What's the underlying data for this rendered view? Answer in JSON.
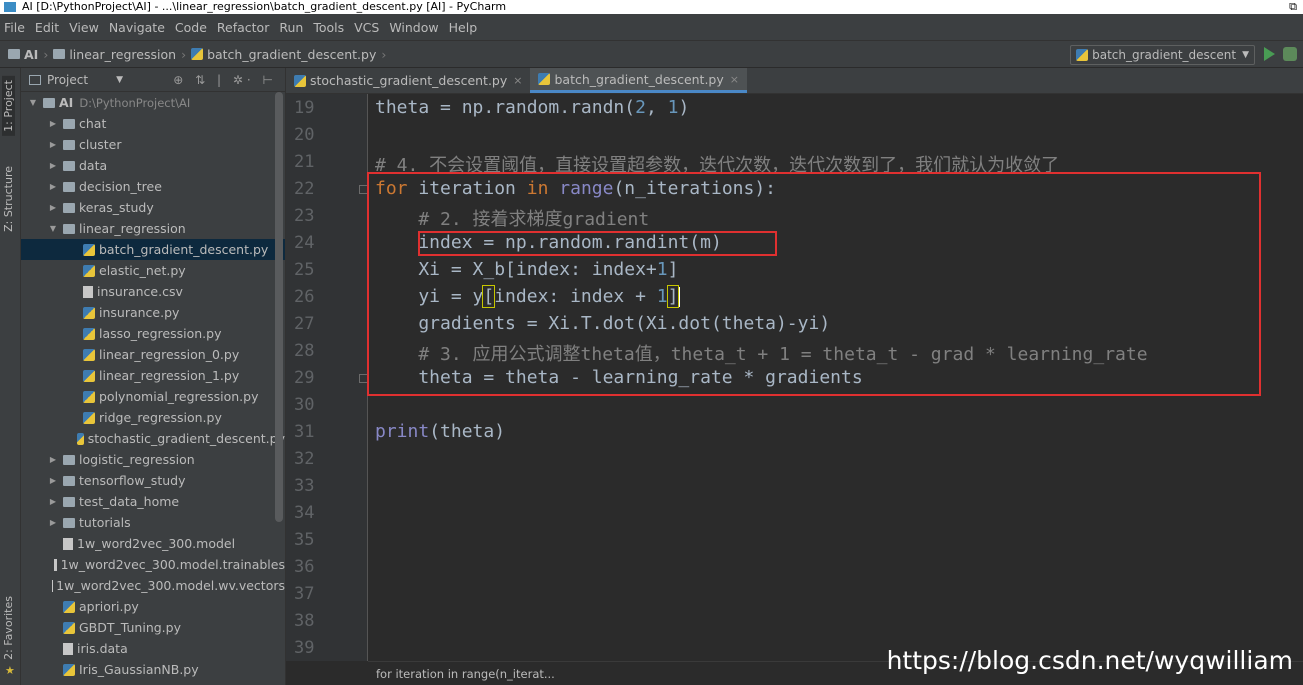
{
  "window": {
    "title": "AI [D:\\PythonProject\\AI] - ...\\linear_regression\\batch_gradient_descent.py [AI] - PyCharm",
    "restore_glyph": "⧉"
  },
  "menu": [
    "File",
    "Edit",
    "View",
    "Navigate",
    "Code",
    "Refactor",
    "Run",
    "Tools",
    "VCS",
    "Window",
    "Help"
  ],
  "nav": {
    "crumbs": [
      "AI",
      "linear_regression",
      "batch_gradient_descent.py"
    ],
    "separator": "›",
    "run_config": "batch_gradient_descent"
  },
  "toolstrip": {
    "project_tab": "1: Project",
    "structure_tab": "Z: Structure",
    "favorites_tab": "2: Favorites"
  },
  "project_panel": {
    "header": "Project",
    "tools": "⊕ ⇅ | ✲· ⊢",
    "tree": [
      {
        "label": "AI",
        "path": "D:\\PythonProject\\AI",
        "type": "folder",
        "indent": 0,
        "arrow": "▼"
      },
      {
        "label": "chat",
        "type": "folder",
        "indent": 1,
        "arrow": "▶"
      },
      {
        "label": "cluster",
        "type": "folder",
        "indent": 1,
        "arrow": "▶"
      },
      {
        "label": "data",
        "type": "folder",
        "indent": 1,
        "arrow": "▶"
      },
      {
        "label": "decision_tree",
        "type": "folder",
        "indent": 1,
        "arrow": "▶"
      },
      {
        "label": "keras_study",
        "type": "folder",
        "indent": 1,
        "arrow": "▶"
      },
      {
        "label": "linear_regression",
        "type": "folder",
        "indent": 1,
        "arrow": "▼"
      },
      {
        "label": "batch_gradient_descent.py",
        "type": "py",
        "indent": 2,
        "selected": true
      },
      {
        "label": "elastic_net.py",
        "type": "py",
        "indent": 2
      },
      {
        "label": "insurance.csv",
        "type": "file",
        "indent": 2
      },
      {
        "label": "insurance.py",
        "type": "py",
        "indent": 2
      },
      {
        "label": "lasso_regression.py",
        "type": "py",
        "indent": 2
      },
      {
        "label": "linear_regression_0.py",
        "type": "py",
        "indent": 2
      },
      {
        "label": "linear_regression_1.py",
        "type": "py",
        "indent": 2
      },
      {
        "label": "polynomial_regression.py",
        "type": "py",
        "indent": 2
      },
      {
        "label": "ridge_regression.py",
        "type": "py",
        "indent": 2
      },
      {
        "label": "stochastic_gradient_descent.py",
        "type": "py",
        "indent": 2
      },
      {
        "label": "logistic_regression",
        "type": "folder",
        "indent": 1,
        "arrow": "▶"
      },
      {
        "label": "tensorflow_study",
        "type": "folder",
        "indent": 1,
        "arrow": "▶"
      },
      {
        "label": "test_data_home",
        "type": "folder",
        "indent": 1,
        "arrow": "▶"
      },
      {
        "label": "tutorials",
        "type": "folder",
        "indent": 1,
        "arrow": "▶"
      },
      {
        "label": "1w_word2vec_300.model",
        "type": "file",
        "indent": 1
      },
      {
        "label": "1w_word2vec_300.model.trainables",
        "type": "file",
        "indent": 1
      },
      {
        "label": "1w_word2vec_300.model.wv.vectors",
        "type": "file",
        "indent": 1
      },
      {
        "label": "apriori.py",
        "type": "py",
        "indent": 1
      },
      {
        "label": "GBDT_Tuning.py",
        "type": "py",
        "indent": 1
      },
      {
        "label": "iris.data",
        "type": "file",
        "indent": 1
      },
      {
        "label": "Iris_GaussianNB.py",
        "type": "py",
        "indent": 1
      }
    ]
  },
  "tabs": [
    {
      "label": "stochastic_gradient_descent.py",
      "active": false
    },
    {
      "label": "batch_gradient_descent.py",
      "active": true
    }
  ],
  "tab_close": "×",
  "editor": {
    "line_numbers": [
      "19",
      "20",
      "21",
      "22",
      "23",
      "24",
      "25",
      "26",
      "27",
      "28",
      "29",
      "30",
      "31",
      "32",
      "33",
      "34",
      "35",
      "36",
      "37",
      "38",
      "39"
    ],
    "lines": [
      [
        {
          "t": "theta = np.random.randn(",
          "c": ""
        },
        {
          "t": "2",
          "c": "num"
        },
        {
          "t": ", ",
          "c": ""
        },
        {
          "t": "1",
          "c": "num"
        },
        {
          "t": ")",
          "c": ""
        }
      ],
      [],
      [
        {
          "t": "# 4. 不会设置阈值，直接设置超参数，迭代次数，迭代次数到了，我们就认为收敛了",
          "c": "cm"
        }
      ],
      [
        {
          "t": "for",
          "c": "kw"
        },
        {
          "t": " iteration ",
          "c": ""
        },
        {
          "t": "in",
          "c": "kw"
        },
        {
          "t": " ",
          "c": ""
        },
        {
          "t": "range",
          "c": "bi"
        },
        {
          "t": "(n_iterations):",
          "c": ""
        }
      ],
      [
        {
          "t": "    # 2. 接着求梯度gradient",
          "c": "cm"
        }
      ],
      [
        {
          "t": "    index = np.random.randint(m)",
          "c": ""
        }
      ],
      [
        {
          "t": "    Xi = X_b[index: index+",
          "c": ""
        },
        {
          "t": "1",
          "c": "num"
        },
        {
          "t": "]",
          "c": ""
        }
      ],
      [
        {
          "t": "    yi = y",
          "c": ""
        },
        {
          "t": "[",
          "c": "hl"
        },
        {
          "t": "index: index + ",
          "c": ""
        },
        {
          "t": "1",
          "c": "num"
        },
        {
          "t": "]",
          "c": "hl"
        },
        {
          "t": "",
          "c": "caret"
        }
      ],
      [
        {
          "t": "    gradients = Xi.T.dot(Xi.dot(theta)-yi)",
          "c": ""
        }
      ],
      [
        {
          "t": "    # 3. 应用公式调整theta值，theta_t + 1 = theta_t - grad * learning_rate",
          "c": "cm"
        }
      ],
      [
        {
          "t": "    theta = theta - learning_rate * gradients",
          "c": ""
        }
      ],
      [],
      [
        {
          "t": "print",
          "c": "bi"
        },
        {
          "t": "(theta)",
          "c": ""
        }
      ]
    ]
  },
  "status_breadcrumb": "for iteration in range(n_iterat...",
  "watermark": "https://blog.csdn.net/wyqwilliam"
}
